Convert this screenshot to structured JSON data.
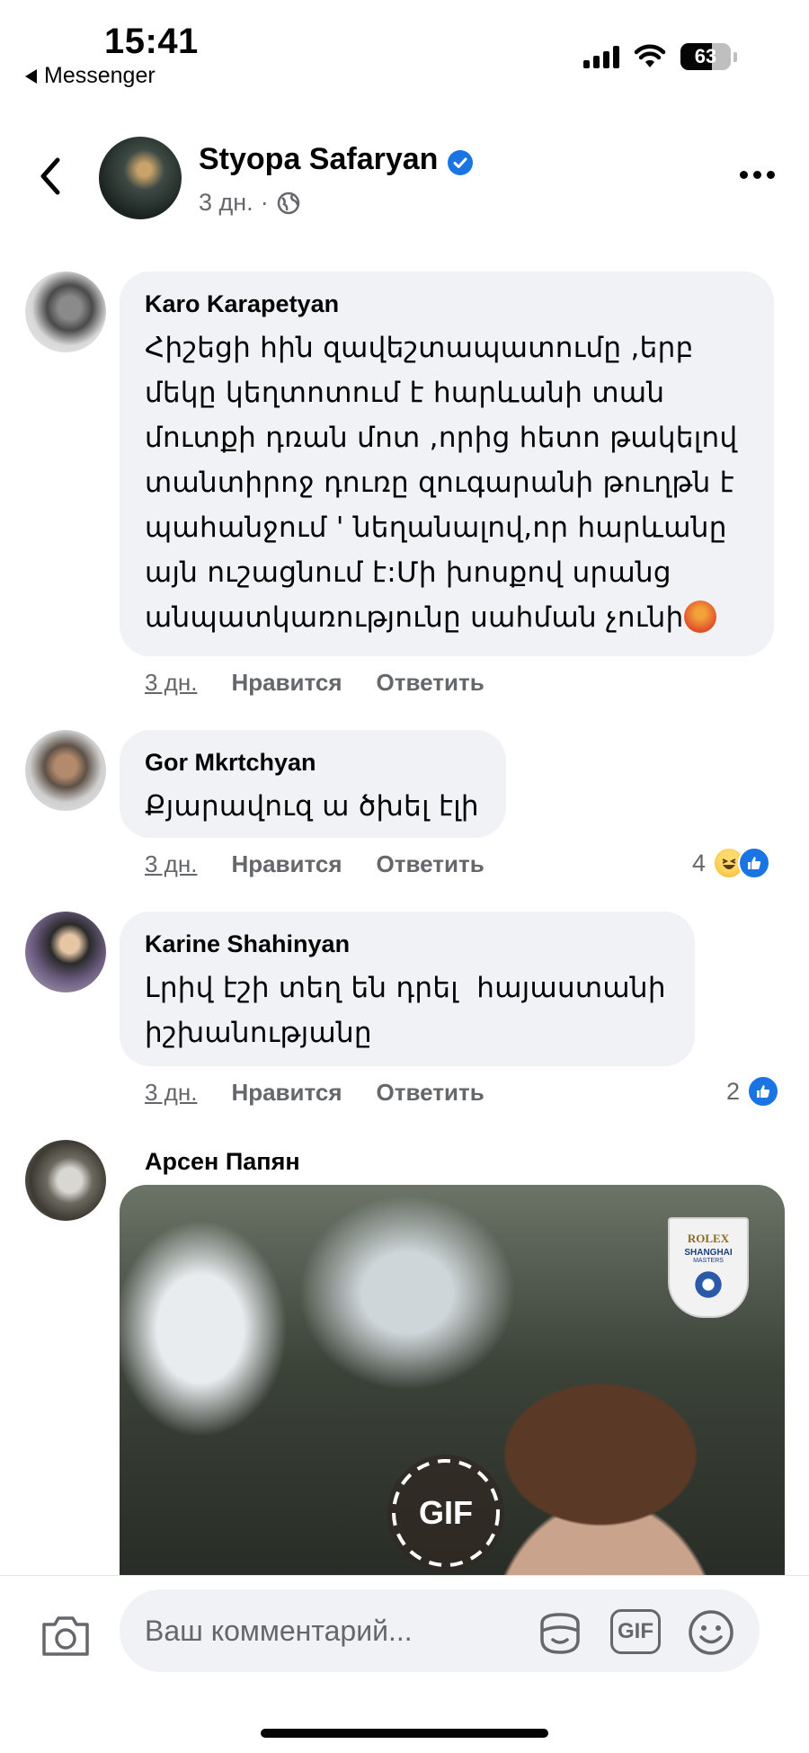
{
  "status_bar": {
    "time": "15:41",
    "back_app": "Messenger",
    "battery": "63",
    "battery_level": 0.63
  },
  "post": {
    "author": "Styopa Safaryan",
    "verified": true,
    "time": "3 дн.",
    "audience_icon": "globe-icon"
  },
  "comments": [
    {
      "author": "Karo Karapetyan",
      "text_lines": [
        "Հիշեցի հին զավեշտապատումը ,երբ",
        "մեկը կեղտոտում է հարևանի տան",
        "մուտքի դռան մոտ ,որից հետո թակելով",
        "տանտիրոջ դուռը զուգարանի թուղթն է",
        "պահանջում ' նեղանալով,որ հարևանը",
        "այն ուշացնում է:Մի խոսքով սրանց",
        "անպատկառությունը սահման չունի"
      ],
      "time": "3 дн.",
      "like_label": "Нравится",
      "reply_label": "Ответить"
    },
    {
      "author": "Gor Mkrtchyan",
      "text_lines": [
        "Քյարավուզ ա ծխել էլի"
      ],
      "time": "3 дн.",
      "like_label": "Нравится",
      "reply_label": "Ответить",
      "reaction_count": "4",
      "reactions": [
        "haha",
        "like"
      ]
    },
    {
      "author": "Karine Shahinyan",
      "text_lines": [
        "Լրիվ էշի տեղ են դրել  հայաստանի",
        "իշխանությանը"
      ],
      "time": "3 дн.",
      "like_label": "Нравится",
      "reply_label": "Ответить",
      "reaction_count": "2",
      "reactions": [
        "like"
      ]
    },
    {
      "author": "Арсен Папян",
      "gif_label": "GIF",
      "gif_logo_lines": [
        "ROLEX",
        "SHANGHAI",
        "MASTERS"
      ]
    }
  ],
  "composer": {
    "placeholder": "Ваш комментарий...",
    "gif_button": "GIF"
  },
  "colors": {
    "bubble": "#f0f2f5",
    "secondary_text": "#65676b",
    "facebook_blue": "#1b74e4"
  }
}
